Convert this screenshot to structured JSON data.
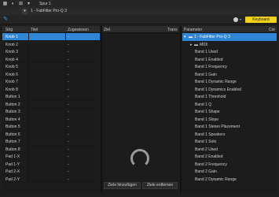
{
  "topbar": {
    "track": "Spur 1"
  },
  "instrument": {
    "name": "1 - FabFilter Pro-Q 3"
  },
  "toolbar": {
    "keyboard_label": "Keyboard"
  },
  "left_table": {
    "columns": [
      "Strg",
      "Titel",
      "Zugewiesen"
    ],
    "rows": [
      {
        "name": "Knob 1",
        "assigned": "-"
      },
      {
        "name": "Knob 2",
        "assigned": "-"
      },
      {
        "name": "Knob 3",
        "assigned": "-"
      },
      {
        "name": "Knob 4",
        "assigned": "-"
      },
      {
        "name": "Knob 5",
        "assigned": "-"
      },
      {
        "name": "Knob 6",
        "assigned": "-"
      },
      {
        "name": "Knob 7",
        "assigned": "-"
      },
      {
        "name": "Knob 8",
        "assigned": "-"
      },
      {
        "name": "Button 1",
        "assigned": "-"
      },
      {
        "name": "Button 2",
        "assigned": "-"
      },
      {
        "name": "Button 3",
        "assigned": "-"
      },
      {
        "name": "Button 4",
        "assigned": "-"
      },
      {
        "name": "Button 5",
        "assigned": "-"
      },
      {
        "name": "Button 6",
        "assigned": "-"
      },
      {
        "name": "Button 7",
        "assigned": "-"
      },
      {
        "name": "Button 8",
        "assigned": "-"
      },
      {
        "name": "Pad 1-X",
        "assigned": "-"
      },
      {
        "name": "Pad 1-Y",
        "assigned": "-"
      },
      {
        "name": "Pad 2-X",
        "assigned": "-"
      },
      {
        "name": "Pad 2-Y",
        "assigned": "-"
      }
    ]
  },
  "middle": {
    "columns": [
      "Ziel",
      "Trans"
    ],
    "add_label": "Ziele hinzufügen",
    "remove_label": "Ziele entfernen"
  },
  "right_tree": {
    "columns": [
      "Parameter",
      "Cor"
    ],
    "root": "1 - FabFilter Pro-Q 3",
    "midi": "MIDI",
    "items": [
      "Band 1 Used",
      "Band 1 Enabled",
      "Band 1 Frequency",
      "Band 1 Gain",
      "Band 1 Dynamic Range",
      "Band 1 Dynamics Enabled",
      "Band 1 Threshold",
      "Band 1 Q",
      "Band 1 Shape",
      "Band 1 Slope",
      "Band 1 Stereo Placement",
      "Band 1 Speakers",
      "Band 1 Solo",
      "Band 2 Used",
      "Band 2 Enabled",
      "Band 2 Frequency",
      "Band 2 Gain",
      "Band 2 Dynamic Range"
    ]
  }
}
